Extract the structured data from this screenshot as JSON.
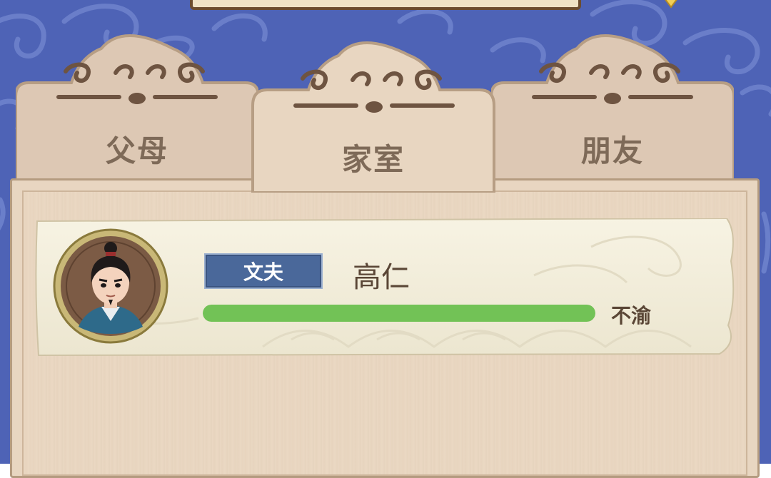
{
  "tabs": [
    {
      "label": "父母",
      "active": false
    },
    {
      "label": "家室",
      "active": true
    },
    {
      "label": "朋友",
      "active": false
    }
  ],
  "relations": [
    {
      "role": "文夫",
      "name": "高仁",
      "mood_label": "不渝",
      "mood_level": 1.0,
      "avatar_icon": "man-portrait-icon"
    }
  ],
  "colors": {
    "background": "#4e63b6",
    "panel": "#e8d6c1",
    "bar_fill": "#72c256",
    "role_badge": "#4a689a",
    "tab_text": "#7e6a58"
  }
}
